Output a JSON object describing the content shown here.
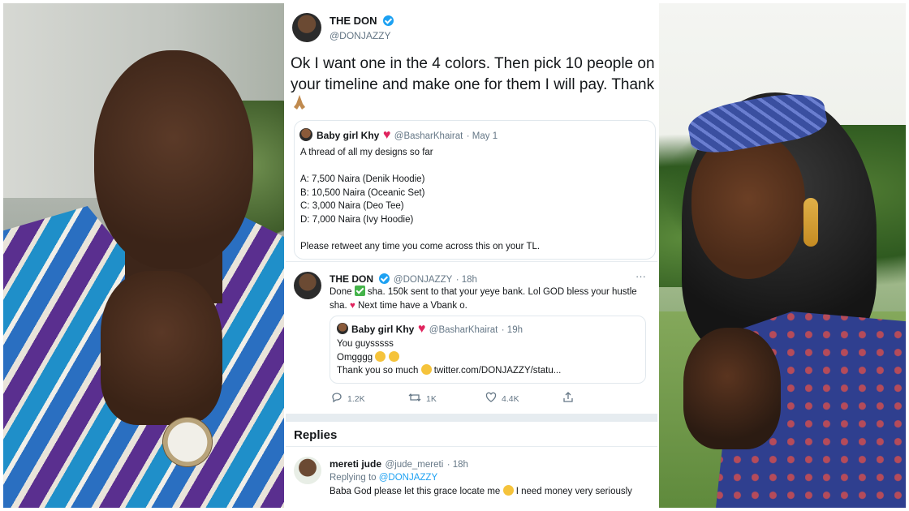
{
  "main_tweet": {
    "author_name": "THE DON",
    "author_handle": "@DONJAZZY",
    "text": "Ok I want one in the 4 colors. Then pick 10 people on your timeline and make one for them I will pay. Thank",
    "trailing_emoji_icon": "folded-hands-icon"
  },
  "quoted_tweet": {
    "author_name": "Baby girl Khy",
    "author_handle": "@BasharKhairat",
    "date": "· May 1",
    "lines": [
      "A thread of all my designs so far",
      "",
      "A: 7,500 Naira (Denik Hoodie)",
      "B: 10,500 Naira (Oceanic Set)",
      "C: 3,000 Naira (Deo Tee)",
      "D: 7,000 Naira (Ivy Hoodie)",
      "",
      "Please retweet any time you come across this on your TL."
    ]
  },
  "reply_tweet": {
    "author_name": "THE DON",
    "author_handle": "@DONJAZZY",
    "time": "· 18h",
    "text_part1": "Done",
    "text_part2": "sha. 150k sent to that your yeye bank. Lol GOD bless your hustle",
    "text_part3": "sha.",
    "text_part4": "Next time have a Vbank o.",
    "more_label": "···",
    "inner_quote": {
      "author_name": "Baby girl Khy",
      "author_handle": "@BasharKhairat",
      "time": "· 19h",
      "line1": "You guysssss",
      "line2": "Omgggg",
      "line3a": "Thank you so much",
      "line3b": "twitter.com/DONJAZZY/statu..."
    },
    "actions": {
      "replies": "1.2K",
      "retweets": "1K",
      "likes": "4.4K"
    }
  },
  "replies_section": {
    "title": "Replies",
    "reply": {
      "author_name": "mereti jude",
      "author_handle": "@jude_mereti",
      "time": "· 18h",
      "replying_to_label": "Replying to",
      "replying_to_handle": "@DONJAZZY",
      "text": "Baba God please let this grace locate me",
      "text2": "I need money very seriously"
    }
  },
  "colors": {
    "twitter_blue": "#1da1f2",
    "heart_red": "#e0245e",
    "secondary_text": "#657786"
  }
}
